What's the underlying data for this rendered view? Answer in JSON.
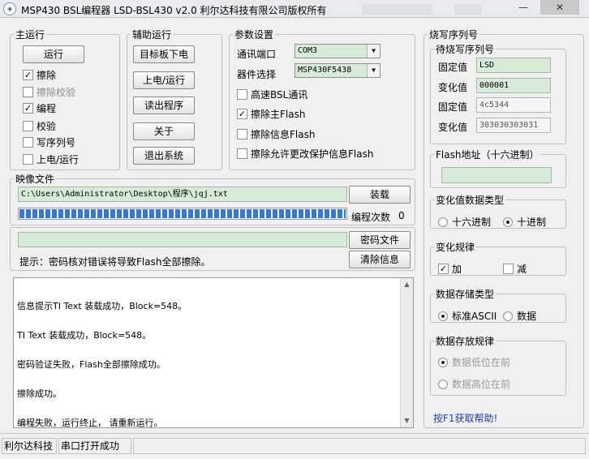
{
  "window": {
    "title": "MSP430 BSL编程器 LSD-BSL430 v2.0 利尔达科技有限公司版权所有",
    "icon_name": "app-logo-icon",
    "minimize_glyph": "—",
    "close_glyph": "✕"
  },
  "main_run": {
    "legend": "主运行",
    "run_label": "运行",
    "options": [
      {
        "label": "擦除",
        "checked": true,
        "enabled": true
      },
      {
        "label": "擦除校验",
        "checked": false,
        "enabled": false
      },
      {
        "label": "编程",
        "checked": true,
        "enabled": true
      },
      {
        "label": "校验",
        "checked": false,
        "enabled": true
      },
      {
        "label": "写序列号",
        "checked": false,
        "enabled": true
      },
      {
        "label": "上电/运行",
        "checked": false,
        "enabled": true
      }
    ]
  },
  "aux_run": {
    "legend": "辅助运行",
    "buttons": [
      "目标板下电",
      "上电/运行",
      "读出程序",
      "关于",
      "退出系统"
    ]
  },
  "params": {
    "legend": "参数设置",
    "port_label": "通讯端口",
    "port_value": "COM3",
    "device_label": "器件选择",
    "device_value": "MSP430F5438",
    "options": [
      {
        "label": "高速BSL通讯",
        "checked": false
      },
      {
        "label": "擦除主Flash",
        "checked": true
      },
      {
        "label": "擦除信息Flash",
        "checked": false
      },
      {
        "label": "擦除允许更改保护信息Flash",
        "checked": false
      }
    ]
  },
  "image_file": {
    "legend": "映像文件",
    "path": "C:\\Users\\Administrator\\Desktop\\程序\\jqj.txt",
    "load_label": "装载",
    "progress": 1.0,
    "program_count_label": "编程次数",
    "program_count": "0"
  },
  "password": {
    "value": "",
    "file_button": "密码文件",
    "hint": "提示：密码核对错误将导致Flash全部擦除。",
    "clear_button": "清除信息"
  },
  "log": {
    "lines": [
      "信息提示TI Text 装载成功，Block=548。",
      "TI Text 装载成功，Block=548。",
      "密码验证失败，Flash全部擦除成功。",
      "擦除成功。",
      "编程失败，运行终止， 请重新运行。"
    ]
  },
  "serial": {
    "legend": "烧写序列号",
    "sub_legend": "待烧写序列号",
    "fixed_label": "固定值",
    "fixed_value": "LSD",
    "var_label": "变化值",
    "var_value": "000001",
    "fixed_label2": "固定值",
    "fixed_readonly": "4c5344",
    "var_label2": "变化值",
    "var_readonly": "303030303031"
  },
  "flash_addr": {
    "legend": "Flash地址（十六进制）",
    "value": ""
  },
  "var_type": {
    "legend": "变化值数据类型",
    "options": [
      {
        "label": "十六进制",
        "selected": false
      },
      {
        "label": "十进制",
        "selected": true
      }
    ]
  },
  "var_rule": {
    "legend": "变化规律",
    "options": [
      {
        "label": "加",
        "checked": true
      },
      {
        "label": "减",
        "checked": false
      }
    ]
  },
  "storage_type": {
    "legend": "数据存储类型",
    "options": [
      {
        "label": "标准ASCII",
        "selected": true
      },
      {
        "label": "数据",
        "selected": false
      }
    ]
  },
  "storage_rule": {
    "legend": "数据存放规律",
    "options": [
      {
        "label": "数据低位在前",
        "selected": true
      },
      {
        "label": "数据高位在前",
        "selected": false
      }
    ]
  },
  "help_text": "按F1获取帮助!",
  "status": {
    "company": "利尔达科技",
    "message": "串口打开成功"
  }
}
